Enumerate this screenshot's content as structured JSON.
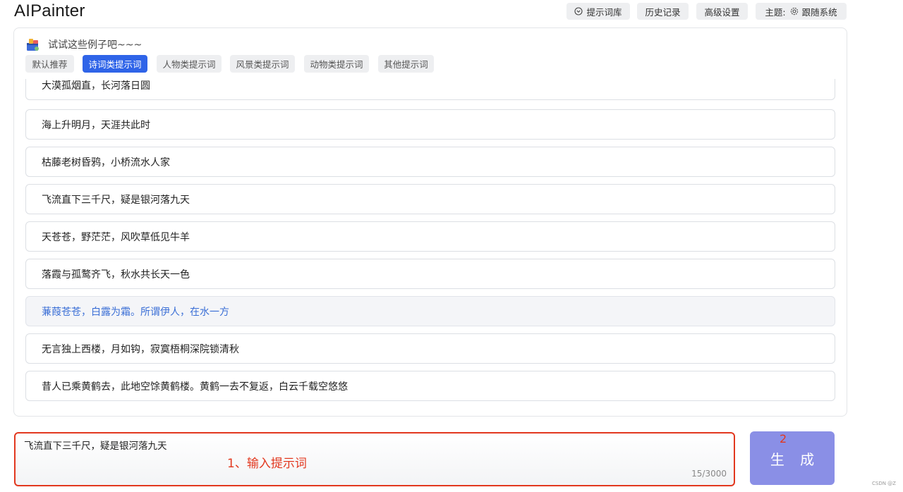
{
  "app": {
    "title": "AIPainter"
  },
  "toolbar": {
    "prompt_library": {
      "label": "提示词库",
      "icon": "circle-chevron-icon"
    },
    "history": {
      "label": "历史记录"
    },
    "advanced": {
      "label": "高级设置"
    },
    "theme": {
      "prefix": "主题:",
      "icon": "gear-icon",
      "value": "跟随系统"
    }
  },
  "examples": {
    "hint": "试试这些例子吧~~~",
    "hint_icon": "toolbox-icon",
    "tabs": [
      "默认推荐",
      "诗词类提示词",
      "人物类提示词",
      "风景类提示词",
      "动物类提示词",
      "其他提示词"
    ],
    "active_tab": "诗词类提示词",
    "items": [
      "大漠孤烟直，长河落日圆",
      "海上升明月，天涯共此时",
      "枯藤老树昏鸦，小桥流水人家",
      "飞流直下三千尺，疑是银河落九天",
      "天苍苍，野茫茫，风吹草低见牛羊",
      "落霞与孤鹜齐飞，秋水共长天一色",
      "蒹葭苍苍，白露为霜。所谓伊人，在水一方",
      "无言独上西楼，月如钩，寂寞梧桐深院锁清秋",
      "昔人已乘黄鹤去，此地空馀黄鹤楼。黄鹤一去不复返，白云千载空悠悠"
    ],
    "hovered_item": "蒹葭苍苍，白露为霜。所谓伊人，在水一方"
  },
  "input": {
    "value": "飞流直下三千尺，疑是银河落九天",
    "counter": "15/3000",
    "annotation": "1、输入提示词"
  },
  "generate": {
    "label": "生 成",
    "annotation": "2"
  },
  "watermark": "CSDN @Z",
  "colors": {
    "accent": "#2f64e8",
    "generate_button": "#8a8fe6",
    "annotation_red": "#e2381f",
    "hover_text": "#3b6fd6"
  }
}
